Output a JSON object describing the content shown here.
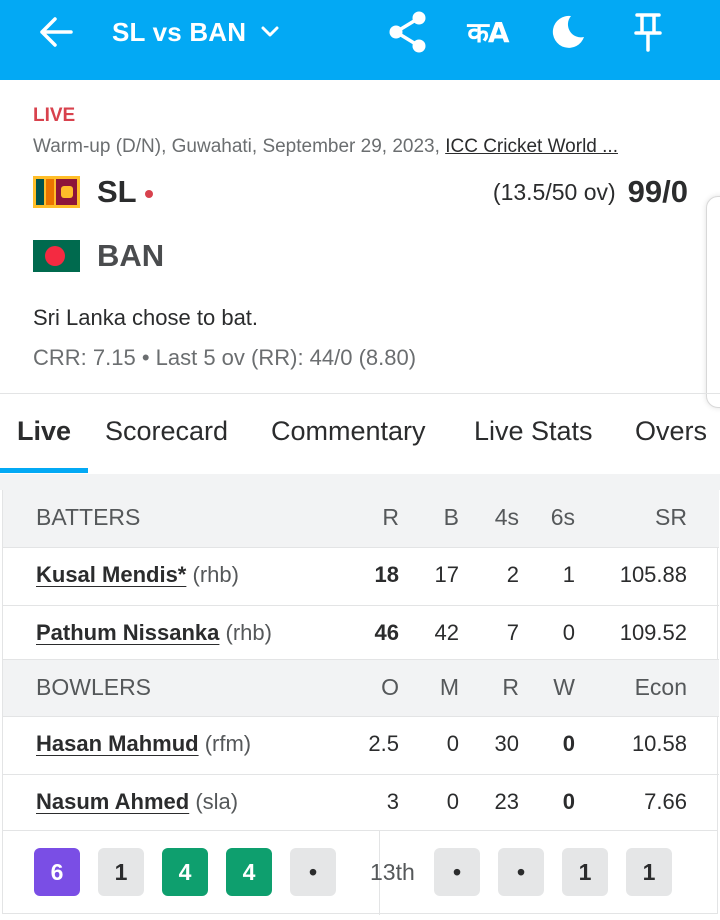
{
  "header": {
    "title": "SL vs BAN",
    "lang_label": "कA",
    "icons": [
      "back-arrow-icon",
      "chevron-down-icon",
      "share-icon",
      "language-icon",
      "moon-icon",
      "pin-icon"
    ]
  },
  "match": {
    "live_label": "LIVE",
    "info": "Warm-up (D/N), Guwahati, September 29, 2023, ",
    "series": "ICC Cricket World ...",
    "team1": {
      "name": "SL",
      "overs": "(13.5/50 ov)",
      "score": "99/0"
    },
    "team2": {
      "name": "BAN"
    },
    "status": "Sri Lanka chose to bat.",
    "crr": "CRR: 7.15 • Last 5 ov (RR): 44/0 (8.80)"
  },
  "tabs": [
    "Live",
    "Scorecard",
    "Commentary",
    "Live Stats",
    "Overs"
  ],
  "batters": {
    "headers": [
      "BATTERS",
      "R",
      "B",
      "4s",
      "6s",
      "SR"
    ],
    "rows": [
      {
        "name": "Kusal Mendis*",
        "style": "(rhb)",
        "r": "18",
        "b": "17",
        "fours": "2",
        "sixes": "1",
        "sr": "105.88"
      },
      {
        "name": "Pathum Nissanka",
        "style": "(rhb)",
        "r": "46",
        "b": "42",
        "fours": "7",
        "sixes": "0",
        "sr": "109.52"
      }
    ]
  },
  "bowlers": {
    "headers": [
      "BOWLERS",
      "O",
      "M",
      "R",
      "W",
      "Econ"
    ],
    "rows": [
      {
        "name": "Hasan Mahmud",
        "style": "(rfm)",
        "o": "2.5",
        "m": "0",
        "r": "30",
        "w": "0",
        "econ": "10.58"
      },
      {
        "name": "Nasum Ahmed",
        "style": "(sla)",
        "o": "3",
        "m": "0",
        "r": "23",
        "w": "0",
        "econ": "7.66"
      }
    ]
  },
  "recent": {
    "prev_balls": [
      "6",
      "1",
      "4",
      "4",
      "•"
    ],
    "over_label": "13th",
    "over_balls": [
      "•",
      "•",
      "1",
      "1"
    ]
  },
  "colors": {
    "brand": "#03a9f4",
    "live": "#d8424d",
    "six": "#7a4ee5",
    "four": "#0e9f6e"
  }
}
